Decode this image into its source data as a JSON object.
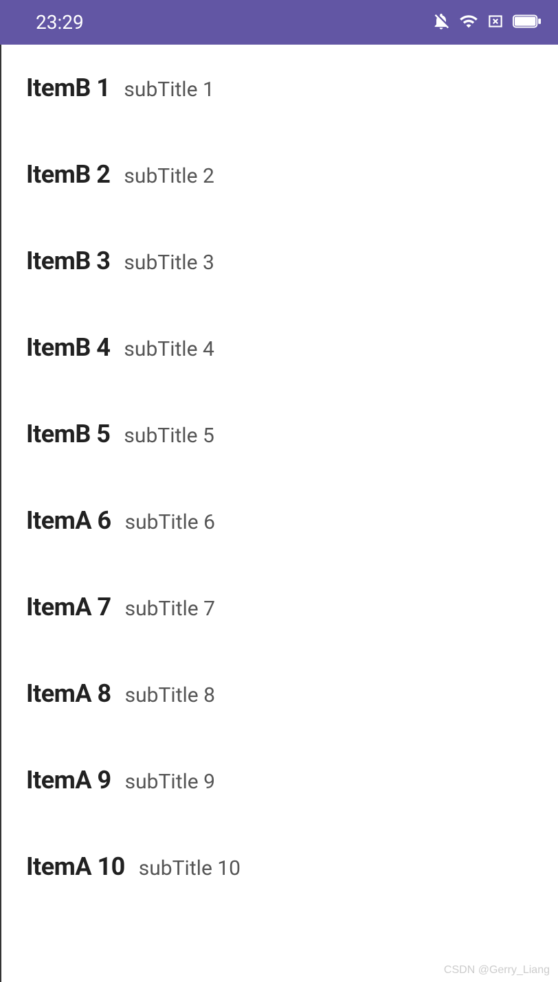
{
  "statusBar": {
    "time": "23:29"
  },
  "list": {
    "items": [
      {
        "title": "ItemB 1",
        "subtitle": "subTitle 1"
      },
      {
        "title": "ItemB 2",
        "subtitle": "subTitle 2"
      },
      {
        "title": "ItemB 3",
        "subtitle": "subTitle 3"
      },
      {
        "title": "ItemB 4",
        "subtitle": "subTitle 4"
      },
      {
        "title": "ItemB 5",
        "subtitle": "subTitle 5"
      },
      {
        "title": "ItemA 6",
        "subtitle": "subTitle 6"
      },
      {
        "title": "ItemA 7",
        "subtitle": "subTitle 7"
      },
      {
        "title": "ItemA 8",
        "subtitle": "subTitle 8"
      },
      {
        "title": "ItemA 9",
        "subtitle": "subTitle 9"
      },
      {
        "title": "ItemA 10",
        "subtitle": "subTitle 10"
      }
    ]
  },
  "watermark": "CSDN @Gerry_Liang"
}
